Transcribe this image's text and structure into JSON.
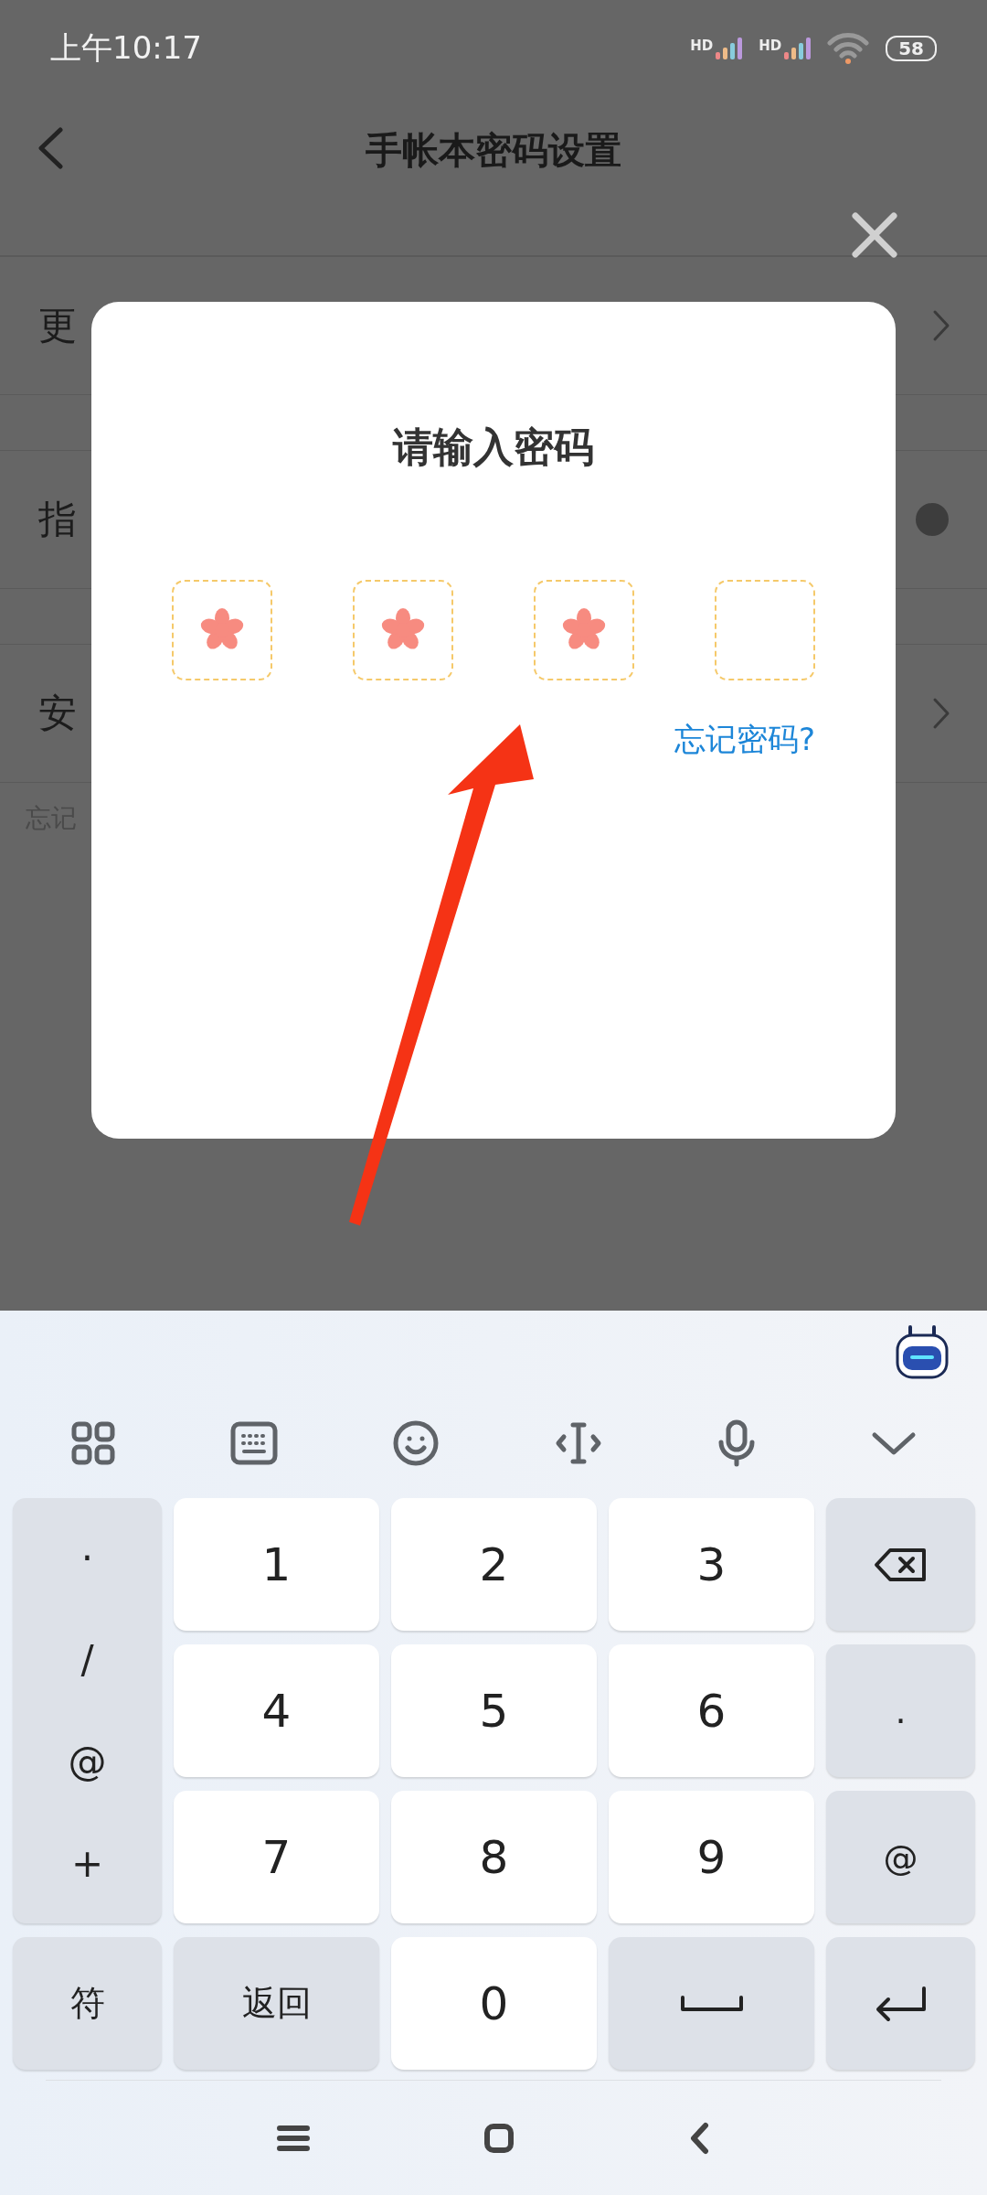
{
  "status_bar": {
    "time": "上午10:17",
    "signals": [
      {
        "label": "HD"
      },
      {
        "label": "HD"
      }
    ],
    "battery": "58"
  },
  "header": {
    "title": "手帐本密码设置"
  },
  "settings": [
    {
      "label": "更",
      "kind": "link"
    },
    {
      "label": "指",
      "kind": "toggle",
      "on": true
    },
    {
      "label": "安",
      "kind": "link"
    }
  ],
  "footnote": "忘记",
  "dialog": {
    "title": "请输入密码",
    "digits": [
      {
        "filled": true
      },
      {
        "filled": true
      },
      {
        "filled": true
      },
      {
        "filled": false
      }
    ],
    "forgot_link": "忘记密码?"
  },
  "keyboard": {
    "keys": [
      {
        "kind": "symbols",
        "symbols": [
          "·",
          "/",
          "@",
          "+"
        ]
      },
      {
        "kind": "digit",
        "label": "1"
      },
      {
        "kind": "digit",
        "label": "2"
      },
      {
        "kind": "digit",
        "label": "3"
      },
      {
        "kind": "backspace"
      },
      {
        "kind": "digit",
        "label": "4"
      },
      {
        "kind": "digit",
        "label": "5"
      },
      {
        "kind": "digit",
        "label": "6"
      },
      {
        "kind": "function",
        "label": "."
      },
      {
        "kind": "digit",
        "label": "7"
      },
      {
        "kind": "digit",
        "label": "8"
      },
      {
        "kind": "digit",
        "label": "9"
      },
      {
        "kind": "function",
        "label": "@"
      },
      {
        "kind": "function",
        "label": "符"
      },
      {
        "kind": "function",
        "label": "返回"
      },
      {
        "kind": "digit",
        "label": "0"
      },
      {
        "kind": "space"
      },
      {
        "kind": "enter"
      }
    ]
  }
}
